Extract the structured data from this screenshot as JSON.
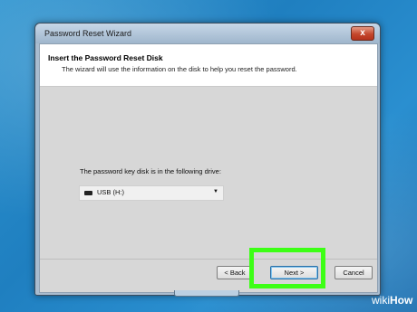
{
  "window": {
    "title": "Password Reset Wizard",
    "close_glyph": "x"
  },
  "header": {
    "title": "Insert the Password Reset Disk",
    "subtitle": "The wizard will use the information on the disk to help you reset the password."
  },
  "main": {
    "drive_prompt": "The password key disk is in the following drive:",
    "drive_select": {
      "value": "USB (H:)",
      "arrow": "▼",
      "icon": "usb-drive-icon"
    }
  },
  "buttons": {
    "back_label": "< Back",
    "next_label": "Next >",
    "cancel_label": "Cancel"
  },
  "annotation": {
    "highlight_color": "#3cff15"
  },
  "watermark": {
    "wiki": "wiki",
    "how": "How"
  }
}
